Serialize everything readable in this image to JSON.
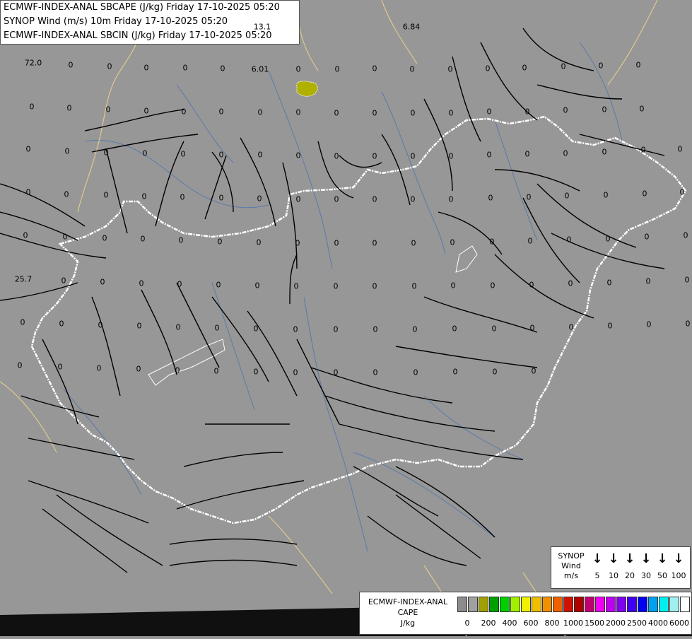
{
  "header": {
    "lines": [
      "ECMWF-INDEX-ANAL SBCAPE (J/kg) Friday 17-10-2025 05:20",
      "SYNOP Wind (m/s) 10m Friday 17-10-2025 05:20",
      "ECMWF-INDEX-ANAL SBCIN (J/kg) Friday 17-10-2025 05:20"
    ]
  },
  "map_values": [
    "72.0",
    "6.01",
    "13.1",
    "6.84",
    "25.7",
    "0",
    "0",
    "0",
    "0",
    "0",
    "0",
    "0",
    "0",
    "0",
    "0",
    "0",
    "0",
    "0",
    "0",
    "0",
    "0",
    "0",
    "0",
    "0",
    "0",
    "0",
    "0",
    "0",
    "0",
    "0",
    "0",
    "0",
    "0",
    "0",
    "0",
    "0",
    "0",
    "0",
    "0",
    "0",
    "0",
    "0",
    "0",
    "0",
    "0",
    "0",
    "0",
    "0",
    "0",
    "0",
    "0",
    "0",
    "0",
    "0",
    "0",
    "0",
    "0",
    "0",
    "0",
    "0",
    "0",
    "0",
    "0",
    "0",
    "0",
    "0",
    "0",
    "0",
    "0",
    "0",
    "0",
    "0",
    "0",
    "0",
    "0",
    "0",
    "0",
    "0",
    "0",
    "0",
    "0",
    "0",
    "0",
    "0",
    "0",
    "0",
    "0",
    "0",
    "0",
    "0",
    "0",
    "0",
    "0",
    "0",
    "0",
    "0",
    "0",
    "0",
    "0",
    "0",
    "0",
    "0",
    "0",
    "0",
    "0",
    "0",
    "0",
    "0",
    "0",
    "0",
    "0",
    "0",
    "0",
    "0",
    "0",
    "0",
    "0",
    "0",
    "0",
    "0",
    "0",
    "0",
    "0",
    "0",
    "0",
    "0",
    "0",
    "0",
    "0",
    "0",
    "0",
    "0",
    "0",
    "0",
    "0",
    "0",
    "0",
    "0",
    "0",
    "0"
  ],
  "wind_legend": {
    "title": [
      "SYNOP",
      "Wind",
      "m/s"
    ],
    "speeds": [
      "5",
      "10",
      "20",
      "30",
      "50",
      "100"
    ]
  },
  "cape_legend": {
    "title": [
      "ECMWF-INDEX-ANAL",
      "CAPE",
      "J/kg"
    ],
    "colors": [
      "#8c8c8c",
      "#a0a0a0",
      "#a0a000",
      "#00a000",
      "#00d000",
      "#a0f000",
      "#f0f000",
      "#f0c000",
      "#f09000",
      "#f06000",
      "#d01000",
      "#b00000",
      "#c00070",
      "#f000f0",
      "#c000f0",
      "#8000f0",
      "#4000f0",
      "#0000f0",
      "#00a0f0",
      "#00f0f0",
      "#a0f0f0",
      "#ffffff"
    ],
    "ticks": [
      "0",
      "200",
      "400",
      "600",
      "800",
      "1000",
      "1500",
      "2000",
      "2500",
      "4000",
      "6000"
    ]
  },
  "colors": {
    "background": "#979797",
    "border": "#ffffff",
    "coast": "#e0c890",
    "river": "#5a7aa8",
    "cape_blob": "#b0b000"
  }
}
